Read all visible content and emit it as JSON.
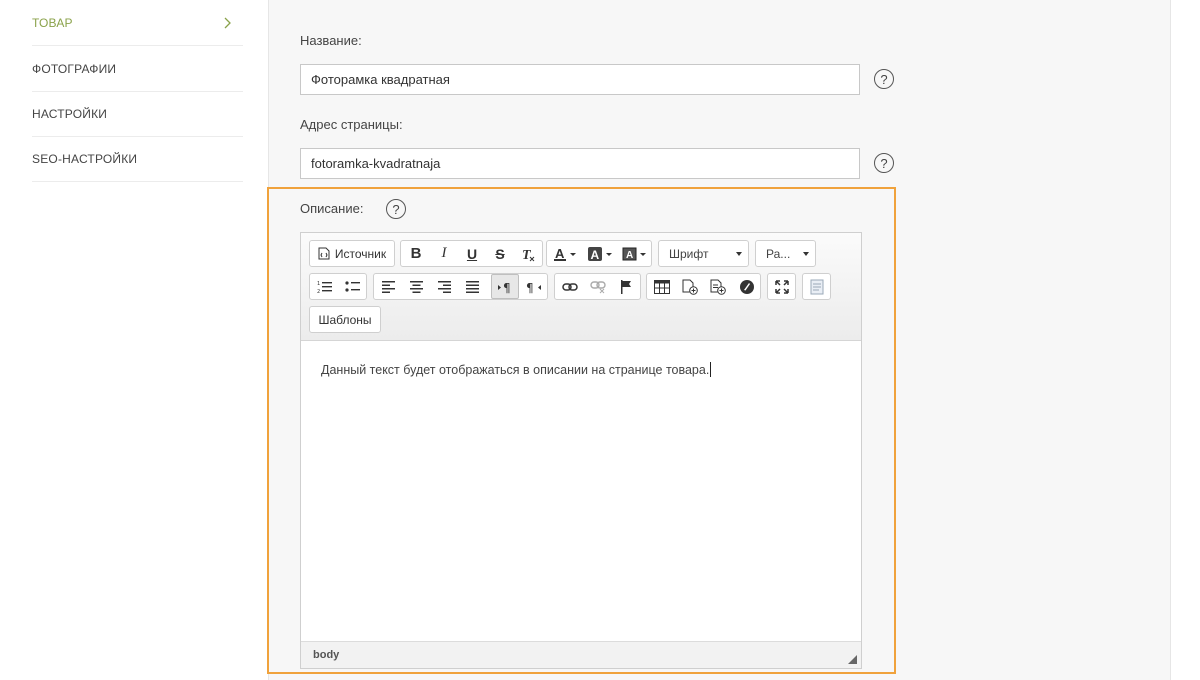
{
  "sidebar": {
    "items": [
      {
        "label": "ТОВАР"
      },
      {
        "label": "ФОТОГРАФИИ"
      },
      {
        "label": "НАСТРОЙКИ"
      },
      {
        "label": "SEO-НАСТРОЙКИ"
      }
    ]
  },
  "form": {
    "name_label": "Название:",
    "name_value": "Фоторамка квадратная",
    "url_label": "Адрес страницы:",
    "url_value": "fotoramka-kvadratnaja",
    "description_label": "Описание:",
    "help_glyph": "?"
  },
  "editor": {
    "source_label": "Источник",
    "font_combo": "Шрифт",
    "size_combo": "Ра...",
    "templates_label": "Шаблоны",
    "content_text": "Данный текст будет отображаться в описании на странице товара.",
    "status_path": "body"
  },
  "colors": {
    "accent": "#8aa24a",
    "highlight": "#f0a23c"
  }
}
